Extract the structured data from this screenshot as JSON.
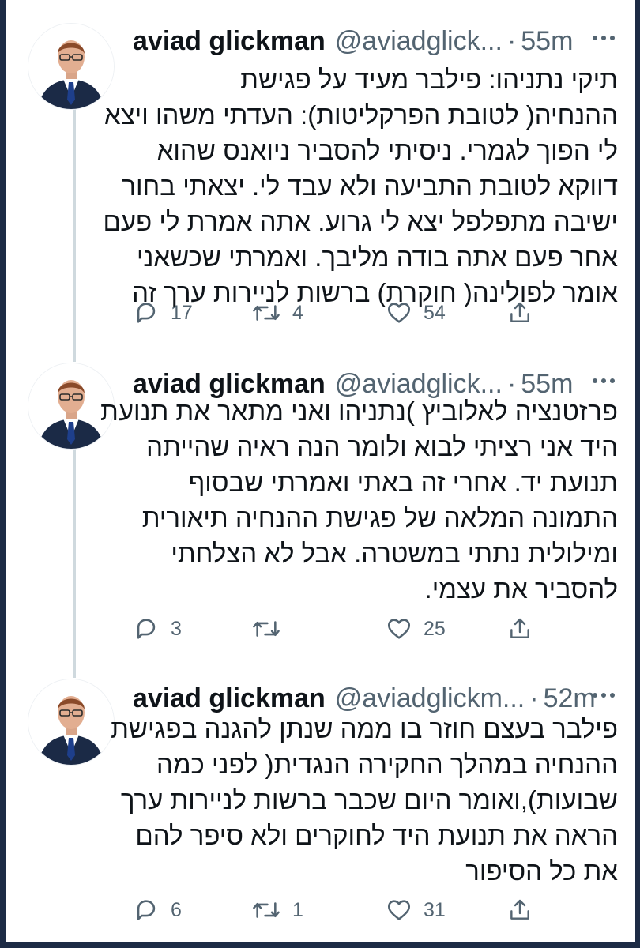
{
  "tweets": [
    {
      "name": "aviad glickman",
      "handle": "@aviadglick...",
      "time": "55m",
      "lines": [
        "תיקי נתניהו: פילבר מעיד על פגישת",
        "ההנחיה( לטובת הפרקליטות): העדתי משהו ויצא",
        "לי הפוך לגמרי. ניסיתי להסביר ניואנס שהוא",
        "דווקא לטובת התביעה ולא עבד לי. יצאתי בחור",
        "ישיבה מתפלפל יצא לי גרוע. אתה אמרת לי פעם",
        "אחר פעם אתה בודה מליבך. ואמרתי שכשאני",
        "אומר לפולינה( חוקרת) ברשות לניירות ערך זה"
      ],
      "replies": "17",
      "retweets": "4",
      "likes": "54"
    },
    {
      "name": "aviad glickman",
      "handle": "@aviadglick...",
      "time": "55m",
      "lines": [
        "פרזטנציה לאלוביץ )נתניהו ואני מתאר את תנועת",
        "היד אני רציתי לבוא ולומר הנה ראיה שהייתה",
        "תנועת יד. אחרי זה באתי ואמרתי שבסוף",
        "התמונה המלאה של פגישת ההנחיה תיאורית",
        "ומילולית נתתי במשטרה. אבל לא הצלחתי",
        "להסביר את עצמי."
      ],
      "replies": "3",
      "retweets": "",
      "likes": "25"
    },
    {
      "name": "aviad glickman",
      "handle": "@aviadglickm...",
      "time": "52m",
      "lines": [
        "פילבר בעצם חוזר בו ממה שנתן להגנה בפגישת",
        "ההנחיה במהלך החקירה הנגדית( לפני כמה",
        "שבועות),ואומר היום שכבר ברשות לניירות ערך",
        "הראה את תנועת היד לחוקרים ולא סיפר להם",
        "את כל הסיפור"
      ],
      "replies": "6",
      "retweets": "1",
      "likes": "31"
    }
  ],
  "icons": {
    "reply": "reply-icon",
    "retweet": "retweet-icon",
    "like": "like-icon",
    "share": "share-icon",
    "more": "more-icon"
  },
  "colors": {
    "outer_background": "#1d2b45",
    "text": "#0f1419",
    "secondary_text": "#536471",
    "thread_line": "#cfd9de",
    "suit": "#1b2a46",
    "tie": "#1e3f8c"
  }
}
